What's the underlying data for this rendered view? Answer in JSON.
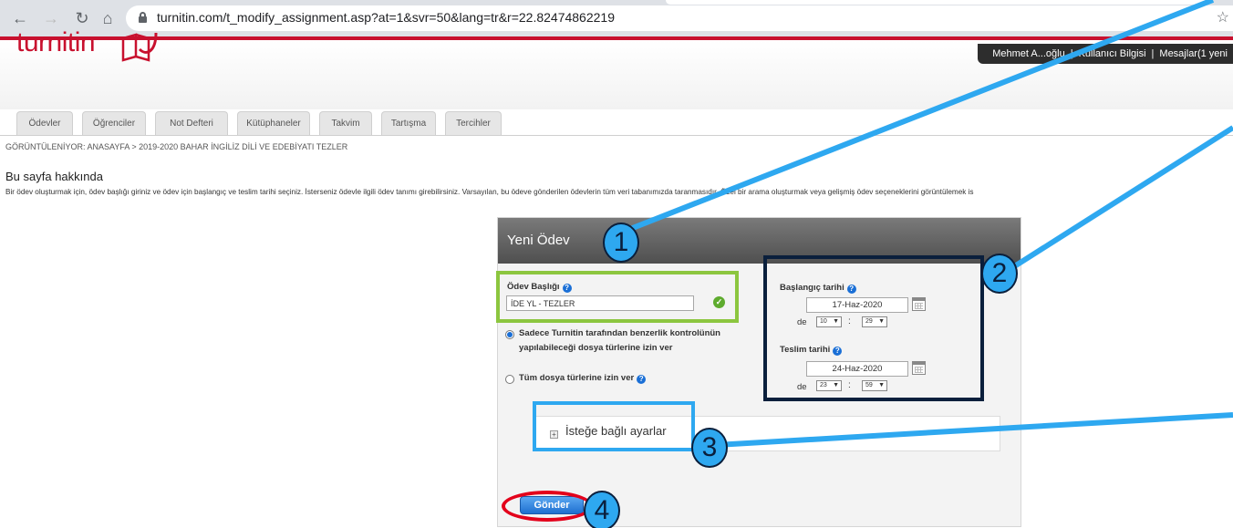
{
  "browser": {
    "url": "turnitin.com/t_modify_assignment.asp?at=1&svr=50&lang=tr&r=22.82474862219"
  },
  "header": {
    "logo": "turnitin",
    "user_name": "Mehmet A...oğlu",
    "user_info": "Kullanıcı Bilgisi",
    "messages": "Mesajlar(1 yeni"
  },
  "tabs": [
    "Ödevler",
    "Öğrenciler",
    "Not Defteri",
    "Kütüphaneler",
    "Takvim",
    "Tartışma",
    "Tercihler"
  ],
  "breadcrumb": "GÖRÜNTÜLENİYOR: ANASAYFA > 2019-2020 BAHAR İNGİLİZ DİLİ VE EDEBİYATI TEZLER",
  "about": {
    "title": "Bu sayfa hakkında",
    "text": "Bir ödev oluşturmak için, ödev başlığı giriniz ve ödev için başlangıç ve teslim tarihi seçiniz. İsterseniz ödevle ilgili ödev tanımı girebilirsiniz. Varsayılan, bu ödeve gönderilen ödevlerin tüm veri tabanımızda taranmasıdır. Özel bir arama oluşturmak veya gelişmiş ödev seçeneklerini görüntülemek is"
  },
  "form": {
    "panel_title": "Yeni Ödev",
    "title_label": "Ödev Başlığı",
    "title_value": "İDE YL - TEZLER",
    "option1": "Sadece Turnitin tarafından benzerlik kontrolünün yapılabileceği dosya türlerine izin ver",
    "option2": "Tüm dosya türlerine izin ver",
    "start_label": "Başlangıç tarihi",
    "start_date": "17-Haz-2020",
    "start_hour": "10",
    "start_minute": "29",
    "due_label": "Teslim tarihi",
    "due_date": "24-Haz-2020",
    "due_hour": "23",
    "due_minute": "59",
    "time_prefix": "de",
    "time_sep": ":",
    "optional_settings": "İsteğe bağlı ayarlar",
    "submit": "Gönder"
  },
  "annotations": {
    "badges": [
      "1",
      "2",
      "3",
      "4"
    ],
    "color_green": "#8cc63f",
    "color_navy": "#0a1f3c",
    "color_blue": "#2ea8f0",
    "color_red": "#e3001b"
  }
}
